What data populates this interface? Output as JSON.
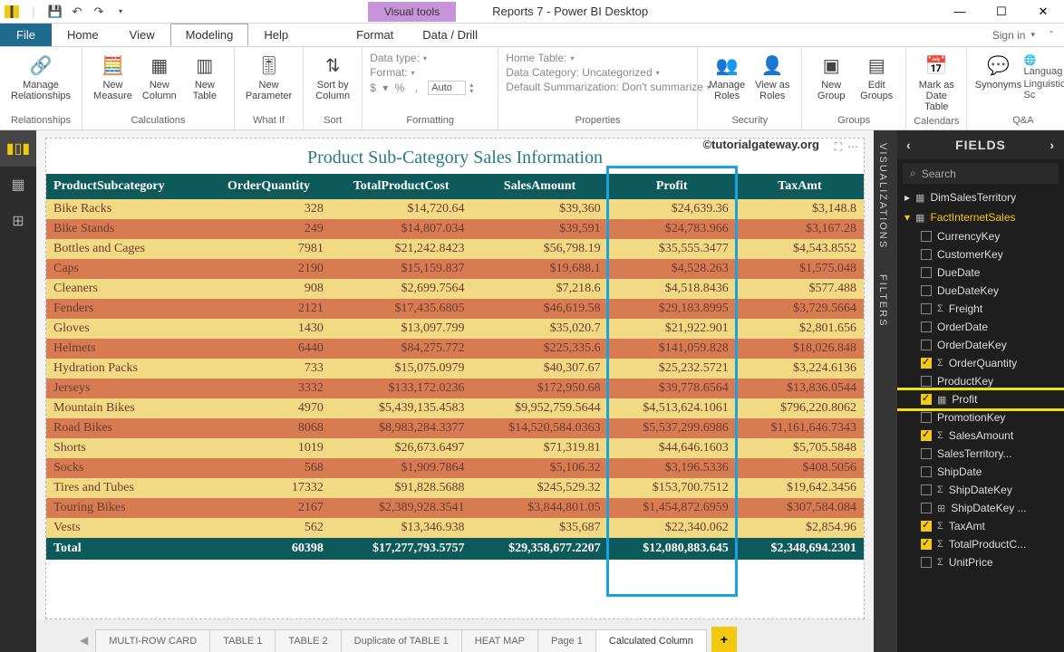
{
  "window": {
    "visual_tools": "Visual tools",
    "title": "Reports 7 - Power BI Desktop",
    "sign_in": "Sign in"
  },
  "tabs": {
    "file": "File",
    "home": "Home",
    "view": "View",
    "modeling": "Modeling",
    "help": "Help",
    "format": "Format",
    "datadrill": "Data / Drill"
  },
  "ribbon": {
    "relationships": {
      "manage": "Manage\nRelationships",
      "group": "Relationships"
    },
    "calculations": {
      "measure": "New\nMeasure",
      "column": "New\nColumn",
      "table": "New\nTable",
      "group": "Calculations"
    },
    "whatif": {
      "param": "New\nParameter",
      "group": "What If"
    },
    "sort": {
      "sortby": "Sort by\nColumn",
      "group": "Sort"
    },
    "formatting": {
      "datatype": "Data type:",
      "format": "Format:",
      "currency": "$",
      "pct": "%",
      "comma": ",",
      "auto": "Auto",
      "group": "Formatting"
    },
    "properties": {
      "home": "Home Table:",
      "datacat": "Data Category: Uncategorized",
      "summ": "Default Summarization: Don't summarize",
      "group": "Properties"
    },
    "security": {
      "manage": "Manage\nRoles",
      "view": "View as\nRoles",
      "group": "Security"
    },
    "groups": {
      "new": "New\nGroup",
      "edit": "Edit\nGroups",
      "group": "Groups"
    },
    "calendars": {
      "mark": "Mark as\nDate Table",
      "group": "Calendars"
    },
    "qa": {
      "syn": "Synonyms",
      "lang": "Languag",
      "ling": "Linguistic Sc",
      "group": "Q&A"
    }
  },
  "watermark": "©tutorialgateway.org",
  "visual": {
    "title": "Product Sub-Category Sales Information",
    "headers": [
      "ProductSubcategory",
      "OrderQuantity",
      "TotalProductCost",
      "SalesAmount",
      "Profit",
      "TaxAmt"
    ],
    "rows": [
      [
        "Bike Racks",
        "328",
        "$14,720.64",
        "$39,360",
        "$24,639.36",
        "$3,148.8"
      ],
      [
        "Bike Stands",
        "249",
        "$14,807.034",
        "$39,591",
        "$24,783.966",
        "$3,167.28"
      ],
      [
        "Bottles and Cages",
        "7981",
        "$21,242.8423",
        "$56,798.19",
        "$35,555.3477",
        "$4,543.8552"
      ],
      [
        "Caps",
        "2190",
        "$15,159.837",
        "$19,688.1",
        "$4,528.263",
        "$1,575.048"
      ],
      [
        "Cleaners",
        "908",
        "$2,699.7564",
        "$7,218.6",
        "$4,518.8436",
        "$577.488"
      ],
      [
        "Fenders",
        "2121",
        "$17,435.6805",
        "$46,619.58",
        "$29,183.8995",
        "$3,729.5664"
      ],
      [
        "Gloves",
        "1430",
        "$13,097.799",
        "$35,020.7",
        "$21,922.901",
        "$2,801.656"
      ],
      [
        "Helmets",
        "6440",
        "$84,275.772",
        "$225,335.6",
        "$141,059.828",
        "$18,026.848"
      ],
      [
        "Hydration Packs",
        "733",
        "$15,075.0979",
        "$40,307.67",
        "$25,232.5721",
        "$3,224.6136"
      ],
      [
        "Jerseys",
        "3332",
        "$133,172.0236",
        "$172,950.68",
        "$39,778.6564",
        "$13,836.0544"
      ],
      [
        "Mountain Bikes",
        "4970",
        "$5,439,135.4583",
        "$9,952,759.5644",
        "$4,513,624.1061",
        "$796,220.8062"
      ],
      [
        "Road Bikes",
        "8068",
        "$8,983,284.3377",
        "$14,520,584.0363",
        "$5,537,299.6986",
        "$1,161,646.7343"
      ],
      [
        "Shorts",
        "1019",
        "$26,673.6497",
        "$71,319.81",
        "$44,646.1603",
        "$5,705.5848"
      ],
      [
        "Socks",
        "568",
        "$1,909.7864",
        "$5,106.32",
        "$3,196.5336",
        "$408.5056"
      ],
      [
        "Tires and Tubes",
        "17332",
        "$91,828.5688",
        "$245,529.32",
        "$153,700.7512",
        "$19,642.3456"
      ],
      [
        "Touring Bikes",
        "2167",
        "$2,389,928.3541",
        "$3,844,801.05",
        "$1,454,872.6959",
        "$307,584.084"
      ],
      [
        "Vests",
        "562",
        "$13,346.938",
        "$35,687",
        "$22,340.062",
        "$2,854.96"
      ]
    ],
    "totals": [
      "Total",
      "60398",
      "$17,277,793.5757",
      "$29,358,677.2207",
      "$12,080,883.645",
      "$2,348,694.2301"
    ]
  },
  "page_tabs": [
    "MULTI-ROW CARD",
    "TABLE 1",
    "TABLE 2",
    "Duplicate of TABLE 1",
    "HEAT MAP",
    "Page 1",
    "Calculated Column"
  ],
  "active_page_index": 6,
  "side_tabs": {
    "viz": "VISUALIZATIONS",
    "filters": "FILTERS"
  },
  "fields": {
    "header": "FIELDS",
    "search": "Search",
    "tables": [
      {
        "name": "DimSalesTerritory",
        "expanded": false
      },
      {
        "name": "FactInternetSales",
        "expanded": true,
        "fields": [
          {
            "name": "CurrencyKey",
            "checked": false
          },
          {
            "name": "CustomerKey",
            "checked": false
          },
          {
            "name": "DueDate",
            "checked": false
          },
          {
            "name": "DueDateKey",
            "checked": false
          },
          {
            "name": "Freight",
            "checked": false,
            "sigma": true
          },
          {
            "name": "OrderDate",
            "checked": false
          },
          {
            "name": "OrderDateKey",
            "checked": false
          },
          {
            "name": "OrderQuantity",
            "checked": true,
            "sigma": true
          },
          {
            "name": "ProductKey",
            "checked": false
          },
          {
            "name": "Profit",
            "checked": true,
            "calc": true,
            "highlight": true
          },
          {
            "name": "PromotionKey",
            "checked": false
          },
          {
            "name": "SalesAmount",
            "checked": true,
            "sigma": true
          },
          {
            "name": "SalesTerritory...",
            "checked": false
          },
          {
            "name": "ShipDate",
            "checked": false
          },
          {
            "name": "ShipDateKey",
            "checked": false,
            "sigma": true
          },
          {
            "name": "ShipDateKey ...",
            "checked": false,
            "hier": true
          },
          {
            "name": "TaxAmt",
            "checked": true,
            "sigma": true
          },
          {
            "name": "TotalProductC...",
            "checked": true,
            "sigma": true
          },
          {
            "name": "UnitPrice",
            "checked": false,
            "sigma": true
          }
        ]
      }
    ]
  },
  "chart_data": {
    "type": "table",
    "title": "Product Sub-Category Sales Information",
    "columns": [
      "ProductSubcategory",
      "OrderQuantity",
      "TotalProductCost",
      "SalesAmount",
      "Profit",
      "TaxAmt"
    ],
    "rows": [
      [
        "Bike Racks",
        328,
        14720.64,
        39360,
        24639.36,
        3148.8
      ],
      [
        "Bike Stands",
        249,
        14807.034,
        39591,
        24783.966,
        3167.28
      ],
      [
        "Bottles and Cages",
        7981,
        21242.8423,
        56798.19,
        35555.3477,
        4543.8552
      ],
      [
        "Caps",
        2190,
        15159.837,
        19688.1,
        4528.263,
        1575.048
      ],
      [
        "Cleaners",
        908,
        2699.7564,
        7218.6,
        4518.8436,
        577.488
      ],
      [
        "Fenders",
        2121,
        17435.6805,
        46619.58,
        29183.8995,
        3729.5664
      ],
      [
        "Gloves",
        1430,
        13097.799,
        35020.7,
        21922.901,
        2801.656
      ],
      [
        "Helmets",
        6440,
        84275.772,
        225335.6,
        141059.828,
        18026.848
      ],
      [
        "Hydration Packs",
        733,
        15075.0979,
        40307.67,
        25232.5721,
        3224.6136
      ],
      [
        "Jerseys",
        3332,
        133172.0236,
        172950.68,
        39778.6564,
        13836.0544
      ],
      [
        "Mountain Bikes",
        4970,
        5439135.4583,
        9952759.5644,
        4513624.1061,
        796220.8062
      ],
      [
        "Road Bikes",
        8068,
        8983284.3377,
        14520584.0363,
        5537299.6986,
        1161646.7343
      ],
      [
        "Shorts",
        1019,
        26673.6497,
        71319.81,
        44646.1603,
        5705.5848
      ],
      [
        "Socks",
        568,
        1909.7864,
        5106.32,
        3196.5336,
        408.5056
      ],
      [
        "Tires and Tubes",
        17332,
        91828.5688,
        245529.32,
        153700.7512,
        19642.3456
      ],
      [
        "Touring Bikes",
        2167,
        2389928.3541,
        3844801.05,
        1454872.6959,
        307584.084
      ],
      [
        "Vests",
        562,
        13346.938,
        35687,
        22340.062,
        2854.96
      ]
    ],
    "totals": [
      "Total",
      60398,
      17277793.5757,
      29358677.2207,
      12080883.645,
      2348694.2301
    ]
  }
}
